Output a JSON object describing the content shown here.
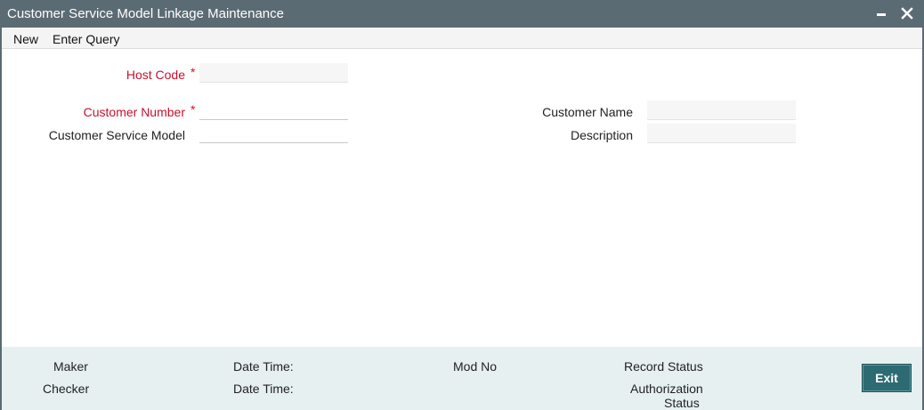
{
  "window": {
    "title": "Customer Service Model Linkage Maintenance"
  },
  "menu": {
    "new_label": "New",
    "enter_query_label": "Enter Query"
  },
  "form": {
    "host_code": {
      "label": "Host Code",
      "required_mark": "*",
      "value": ""
    },
    "customer_number": {
      "label": "Customer Number",
      "required_mark": "*",
      "value": ""
    },
    "customer_service_model": {
      "label": "Customer Service Model",
      "value": ""
    },
    "customer_name": {
      "label": "Customer Name",
      "value": ""
    },
    "description": {
      "label": "Description",
      "value": ""
    }
  },
  "footer": {
    "maker_label": "Maker",
    "checker_label": "Checker",
    "maker_datetime_label": "Date Time:",
    "checker_datetime_label": "Date Time:",
    "mod_no_label": "Mod No",
    "record_status_label": "Record Status",
    "authorization_status_label_line1": "Authorization",
    "authorization_status_label_line2": "Status",
    "exit_label": "Exit"
  },
  "colors": {
    "titlebar": "#5b6b73",
    "required": "#c8102e",
    "footer_bg": "#e6f0f0",
    "exit_button": "#2d6b72"
  }
}
